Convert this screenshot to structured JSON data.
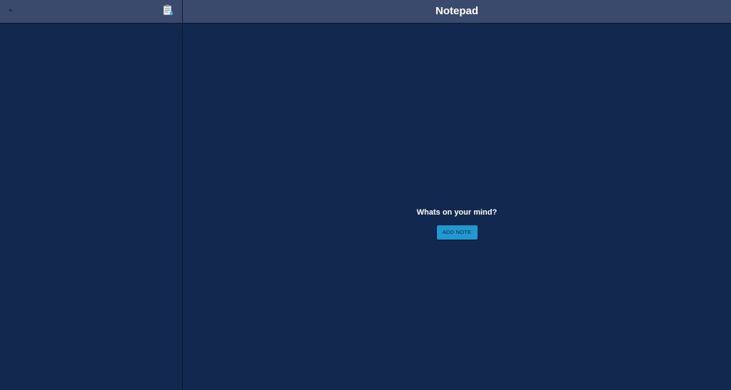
{
  "sidebar": {
    "add_label": "+",
    "clipboard_icon": "clipboard-icon"
  },
  "header": {
    "title": "Notepad"
  },
  "empty_state": {
    "prompt": "Whats on your mind?",
    "button_label": "ADD NOTE"
  },
  "colors": {
    "background": "#13284f",
    "header": "#3a4a6c",
    "accent": "#1e9ad1",
    "text": "#ffffff"
  }
}
